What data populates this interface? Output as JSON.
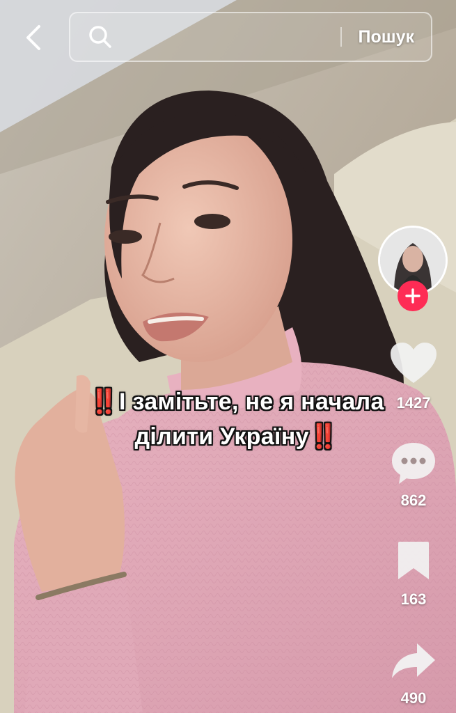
{
  "header": {
    "back_icon": "chevron-left-icon",
    "search_icon": "search-icon",
    "search_placeholder": "",
    "search_button_label": "Пошук"
  },
  "caption": {
    "line1": "І замітьте, не я начала",
    "line2": "ділити Україну",
    "mark": "‼️",
    "mark_color": "#e8202a"
  },
  "actions": {
    "follow_icon": "plus-icon",
    "follow_color": "#fe2c55",
    "like": {
      "icon": "heart-icon",
      "count": "1427"
    },
    "comment": {
      "icon": "comment-icon",
      "count": "862"
    },
    "save": {
      "icon": "bookmark-icon",
      "count": "163"
    },
    "share": {
      "icon": "share-icon",
      "count": "490"
    }
  }
}
